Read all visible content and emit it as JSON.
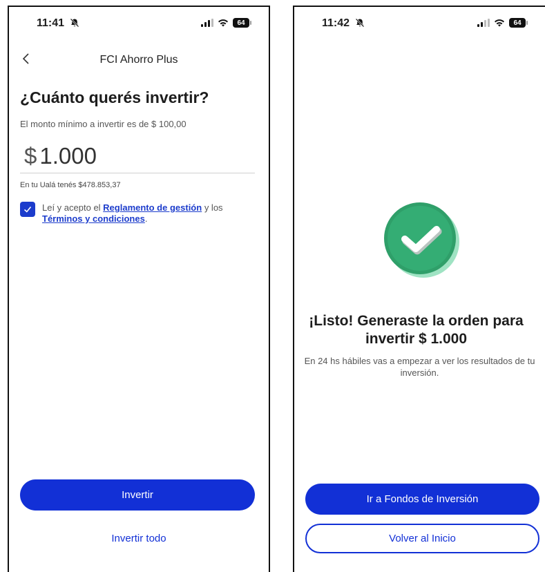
{
  "screen1": {
    "status": {
      "time": "11:41",
      "battery": "64"
    },
    "nav_title": "FCI Ahorro Plus",
    "heading": "¿Cuánto querés invertir?",
    "min_text": "El monto mínimo a invertir es de $ 100,00",
    "amount_currency": "$",
    "amount_value": "1.000",
    "balance_text": "En tu Ualá tenés $478.853,37",
    "terms_prefix": "Leí y acepto el ",
    "terms_link1": "Reglamento de gestión",
    "terms_middle": " y los ",
    "terms_link2": "Términos y condiciones",
    "terms_suffix": ".",
    "invest_button": "Invertir",
    "invest_all_link": "Invertir todo"
  },
  "screen2": {
    "status": {
      "time": "11:42",
      "battery": "64"
    },
    "title": "¡Listo! Generaste la orden para invertir $ 1.000",
    "subtitle": "En 24 hs hábiles vas a empezar a ver los resultados de tu inversión.",
    "funds_button": "Ir a Fondos de Inversión",
    "home_button": "Volver al Inicio"
  },
  "colors": {
    "primary": "#1230d6",
    "success": "#2fa26a"
  }
}
